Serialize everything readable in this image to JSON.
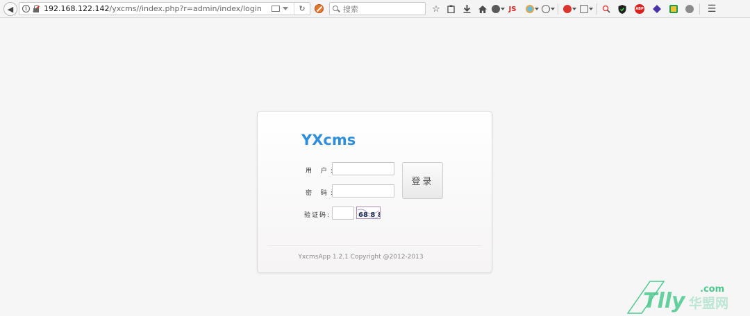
{
  "browser": {
    "url_host": "192.168.122.142",
    "url_path": "/yxcms//index.php?r=admin/index/login",
    "search_placeholder": "搜索",
    "js_label": "JS",
    "abp_label": "ABP"
  },
  "login": {
    "logo": "YXcms",
    "username_label": "用 户:",
    "password_label": "密 码:",
    "captcha_label": "验证码:",
    "username_value": "",
    "password_value": "",
    "captcha_value": "",
    "captcha_text": "68 8 8",
    "login_button": "登录",
    "copyright": "YxcmsApp 1.2.1 Copyright @2012-2013"
  },
  "watermark": {
    "brand": "Tlly",
    "suffix": ".com",
    "site": "华盟网"
  },
  "colors": {
    "logo": "#2f8edb",
    "watermark_green": "#4cc88e"
  }
}
